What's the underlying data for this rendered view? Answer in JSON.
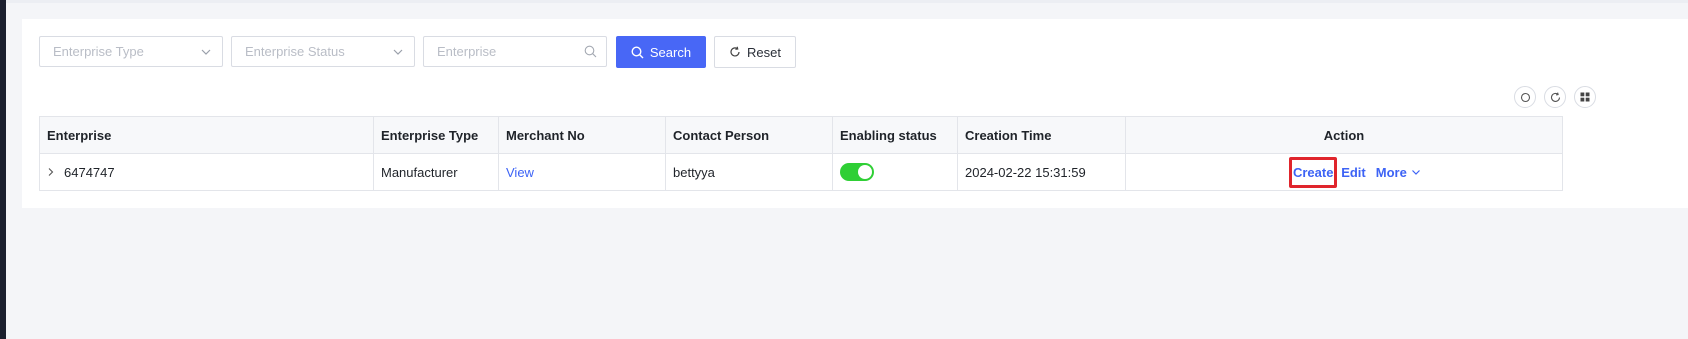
{
  "filters": {
    "enterprise_type_placeholder": "Enterprise Type",
    "enterprise_status_placeholder": "Enterprise Status",
    "enterprise_placeholder": "Enterprise",
    "search_label": "Search",
    "reset_label": "Reset"
  },
  "toolbar_icons": [
    "search-icon",
    "refresh-icon",
    "grid-settings-icon"
  ],
  "table": {
    "columns": [
      "Enterprise",
      "Enterprise Type",
      "Merchant No",
      "Contact Person",
      "Enabling status",
      "Creation Time",
      "Action"
    ],
    "rows": [
      {
        "enterprise": "6474747",
        "enterprise_type": "Manufacturer",
        "merchant_no": "View",
        "contact_person": "bettyya",
        "enabling_status": true,
        "creation_time": "2024-02-22 15:31:59",
        "actions": {
          "create": "Create",
          "edit": "Edit",
          "more": "More"
        }
      }
    ]
  },
  "colors": {
    "primary": "#4867f6",
    "link": "#3d63f5",
    "toggle_on": "#2fcf35",
    "highlight": "#e0252c"
  }
}
